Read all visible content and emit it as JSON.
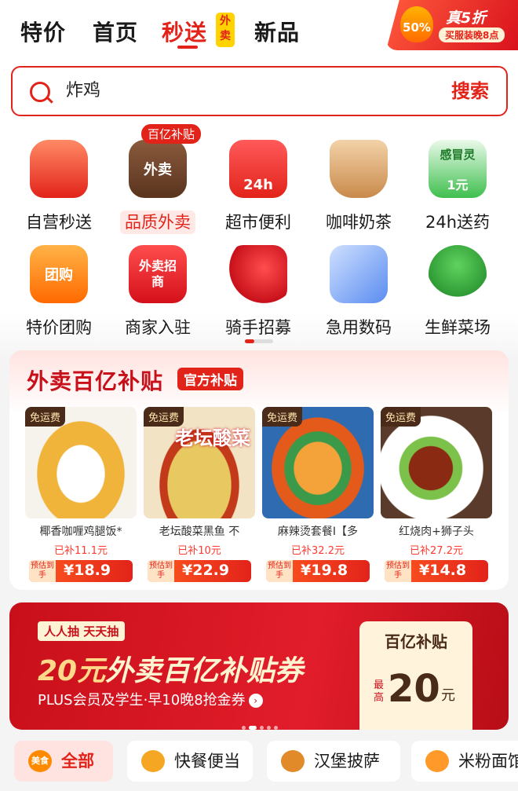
{
  "nav": {
    "tabs": [
      "特价",
      "首页",
      "秒送",
      "新品"
    ],
    "active_badge": "外卖"
  },
  "promo": {
    "title": "真5折",
    "percent": "50%",
    "subtitle": "买服装晚8点"
  },
  "search": {
    "query": "炸鸡",
    "button": "搜索"
  },
  "categories": [
    {
      "label": "自营秒送",
      "icon": "fruit-basket-icon"
    },
    {
      "label": "品质外卖",
      "icon": "takeout-bag-icon",
      "icon_text": "外卖",
      "tag": "百亿补贴"
    },
    {
      "label": "超市便利",
      "icon": "store-24h-icon",
      "icon_text": "24h"
    },
    {
      "label": "咖啡奶茶",
      "icon": "coffee-cup-icon"
    },
    {
      "label": "24h送药",
      "icon": "medicine-box-icon",
      "icon_text": "感冒灵",
      "icon_sub": "1元"
    },
    {
      "label": "特价团购",
      "icon": "group-buy-ticket-icon",
      "icon_text": "团购"
    },
    {
      "label": "商家入驻",
      "icon": "merchant-join-icon",
      "icon_text": "外卖招商"
    },
    {
      "label": "骑手招募",
      "icon": "rider-icon"
    },
    {
      "label": "急用数码",
      "icon": "phone-cable-icon"
    },
    {
      "label": "生鲜菜场",
      "icon": "broccoli-icon"
    }
  ],
  "subsidy": {
    "title": "外卖百亿补贴",
    "badge": "官方补贴",
    "products": [
      {
        "tag": "免运费",
        "name": "椰香咖喱鸡腿饭*",
        "subsidy": "已补11.1元",
        "est": "预估到手",
        "price": "¥18.9"
      },
      {
        "tag": "免运费",
        "name": "老坛酸菜黑鱼 不",
        "subsidy": "已补10元",
        "est": "预估到手",
        "price": "¥22.9",
        "img_text": "老坛酸菜"
      },
      {
        "tag": "免运费",
        "name": "麻辣烫套餐I【多",
        "subsidy": "已补32.2元",
        "est": "预估到手",
        "price": "¥19.8"
      },
      {
        "tag": "免运费",
        "name": "红烧肉+狮子头",
        "subsidy": "已补27.2元",
        "est": "预估到手",
        "price": "¥14.8"
      }
    ]
  },
  "banner": {
    "tag": "人人抽 天天抽",
    "title_amount": "20元",
    "title_rest": "外卖百亿补贴券",
    "subtitle": "PLUS会员及学生·早10晚8抢金券",
    "coupon_title": "百亿补贴",
    "coupon_max": "最高",
    "coupon_value": "20",
    "coupon_unit": "元"
  },
  "chips": [
    {
      "label": "全部",
      "icon": "food-icon",
      "icon_text": "美食"
    },
    {
      "label": "快餐便当",
      "icon": "bento-icon"
    },
    {
      "label": "汉堡披萨",
      "icon": "burger-icon"
    },
    {
      "label": "米粉面馆",
      "icon": "noodle-icon"
    }
  ],
  "colors": {
    "accent": "#e2231a",
    "dark_brown": "#4a2a18"
  }
}
